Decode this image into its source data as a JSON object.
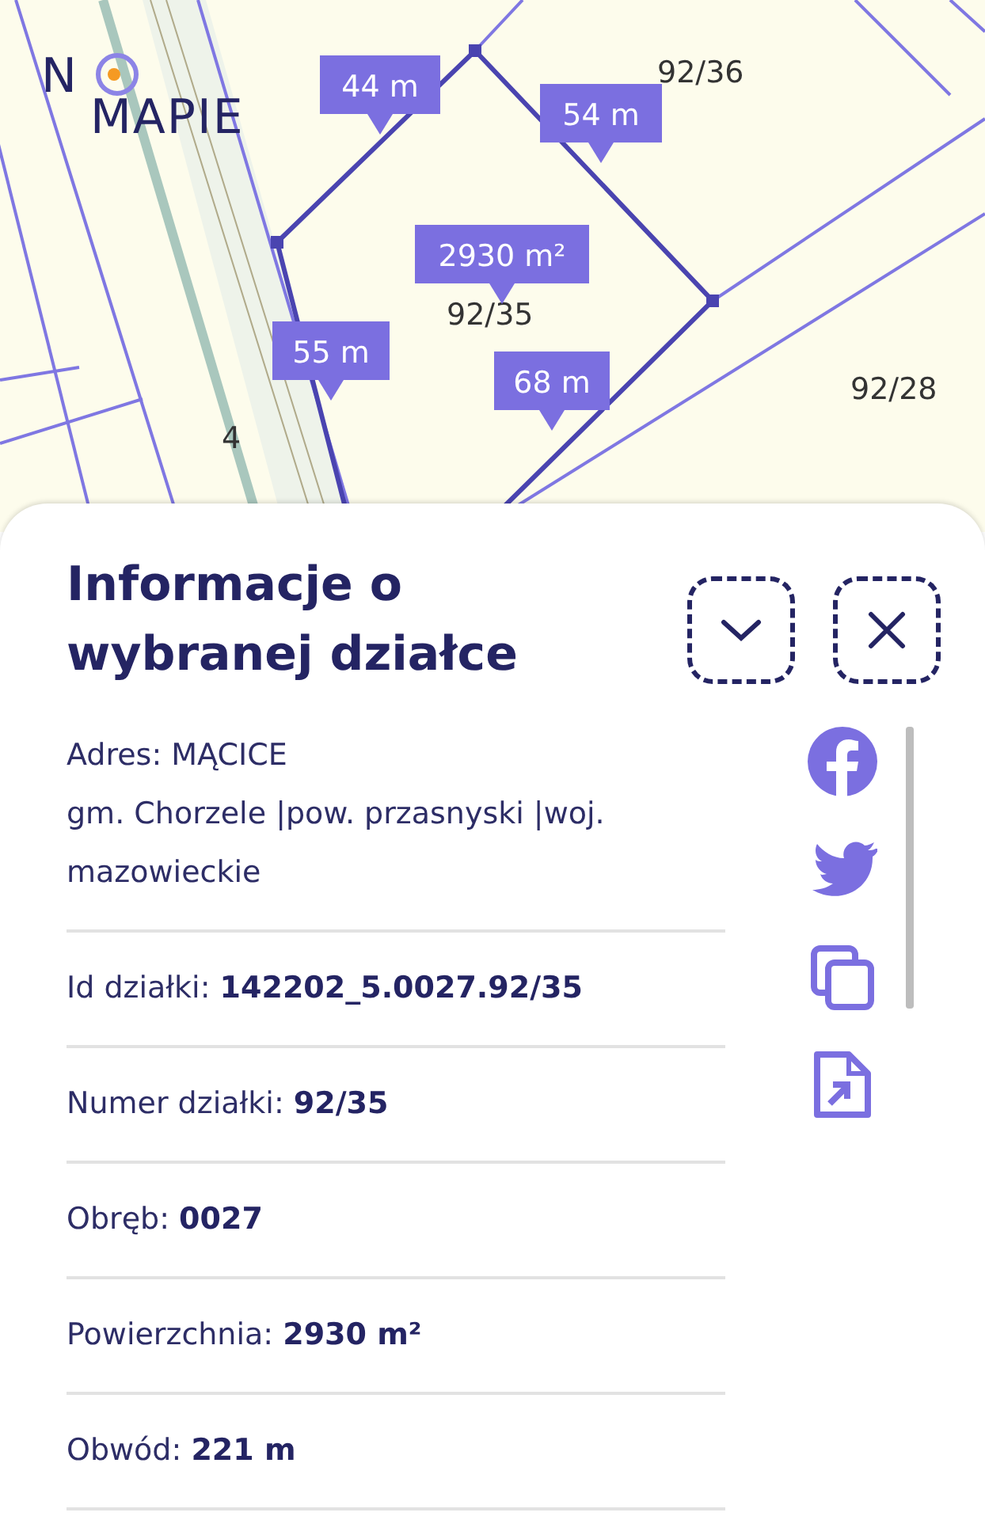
{
  "logo": {
    "line1": "N",
    "line2": "MAPIE"
  },
  "map": {
    "parcel_labels": [
      "92/36",
      "92/35",
      "92/28",
      "4"
    ],
    "measurements": [
      "44 m",
      "54 m",
      "2930 m²",
      "55 m",
      "68 m"
    ]
  },
  "panel": {
    "title": "Informacje o wybranej działce",
    "address": {
      "line1": "Adres: MĄCICE",
      "line2": "gm. Chorzele |pow. przasnyski |woj. mazowieckie"
    },
    "rows": [
      {
        "text": "Id działki: **142202_5.0027.92/35**"
      },
      {
        "text": "Numer działki: **92/35**"
      },
      {
        "text": "Obręb: **0027**"
      },
      {
        "text": "Powierzchnia: **2930 m²**"
      },
      {
        "text": "Obwód: **221 m**"
      }
    ],
    "actions": [
      {
        "kind": "facebook"
      },
      {
        "kind": "twitter"
      },
      {
        "kind": "copy"
      },
      {
        "kind": "export"
      }
    ]
  }
}
